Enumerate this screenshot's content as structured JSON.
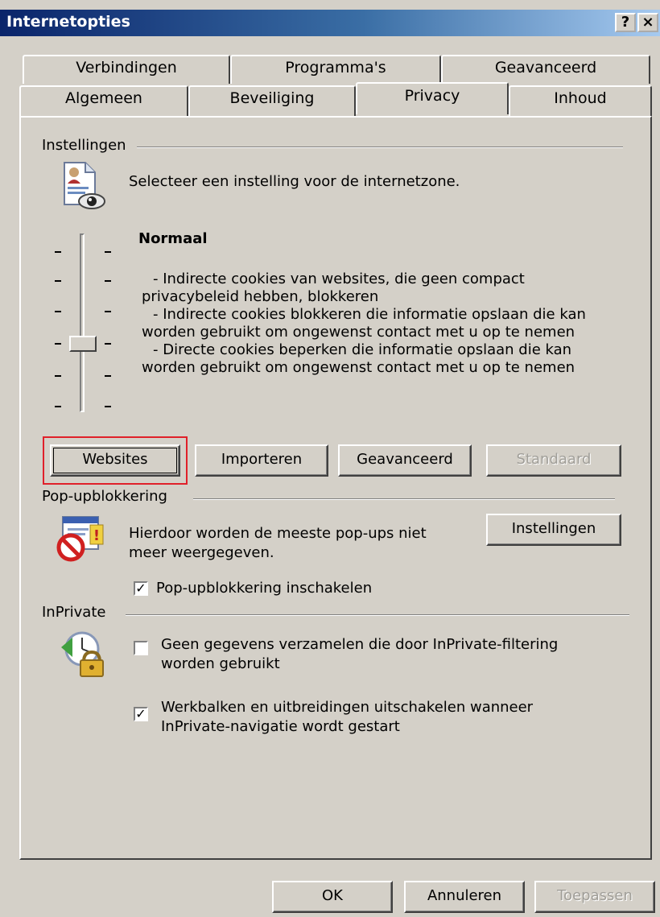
{
  "window": {
    "title": "Internetopties",
    "help_button": "?",
    "close_button": "×"
  },
  "tabs": {
    "row1": [
      "Verbindingen",
      "Programma's",
      "Geavanceerd"
    ],
    "row2": [
      "Algemeen",
      "Beveiliging",
      "Privacy",
      "Inhoud"
    ],
    "active": "Privacy"
  },
  "settings": {
    "group_label": "Instellingen",
    "intro": "Selecteer een instelling voor de internetzone.",
    "level_title": "Normaal",
    "level_desc": [
      "- Indirecte cookies van websites, die geen compact",
      "privacybeleid hebben, blokkeren",
      "- Indirecte cookies blokkeren die informatie opslaan die kan",
      "worden gebruikt om ongewenst contact met u op te nemen",
      "- Directe cookies beperken die informatie opslaan die kan",
      "worden gebruikt om ongewenst contact met u op te nemen"
    ],
    "buttons": {
      "websites": "Websites",
      "import": "Importeren",
      "advanced": "Geavanceerd",
      "default": "Standaard"
    }
  },
  "popup": {
    "group_label": "Pop-upblokkering",
    "desc_line1": "Hierdoor worden de meeste pop-ups niet",
    "desc_line2": "meer weergegeven.",
    "settings_button": "Instellingen",
    "checkbox_label": "Pop-upblokkering inschakelen",
    "checked": true
  },
  "inprivate": {
    "group_label": "InPrivate",
    "option1_line1": "Geen gegevens verzamelen die door InPrivate-filtering",
    "option1_line2": "worden gebruikt",
    "option1_checked": false,
    "option2_line1": "Werkbalken en uitbreidingen uitschakelen wanneer",
    "option2_line2": "InPrivate-navigatie wordt gestart",
    "option2_checked": true
  },
  "footer": {
    "ok": "OK",
    "cancel": "Annuleren",
    "apply": "Toepassen"
  },
  "colors": {
    "dialog_bg": "#d4d0c8",
    "title_gradient_start": "#0a246a",
    "highlight_box": "#e0202a"
  }
}
